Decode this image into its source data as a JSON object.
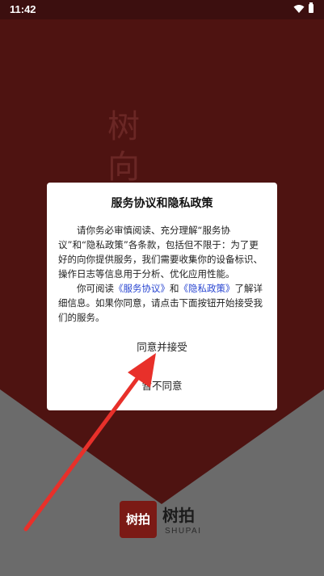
{
  "status_bar": {
    "time": "11:42",
    "icons": [
      "wifi-icon",
      "battery-icon"
    ]
  },
  "splash": {
    "slogan_vertical": "树向着",
    "brand_logo_text": "树拍",
    "brand_name": "树拍",
    "brand_subtitle": "SHUPAI",
    "colors": {
      "background_red": "#4e1311",
      "envelope_gray": "#6b6b6b",
      "logo_red": "#7b1a15"
    }
  },
  "dialog": {
    "title": "服务协议和隐私政策",
    "paragraph1": "请你务必审慎阅读、充分理解“服务协议”和“隐私政策”各条款，包括但不限于：为了更好的向你提供服务，我们需要收集你的设备标识、操作日志等信息用于分析、优化应用性能。",
    "paragraph2_prefix": "你可阅读",
    "terms_link": "《服务协议》",
    "paragraph2_and": "和",
    "privacy_link": "《隐私政策》",
    "paragraph2_suffix": "了解详细信息。如果你同意，请点击下面按钮开始接受我们的服务。",
    "agree_label": "同意并接受",
    "disagree_label": "暂不同意",
    "link_color": "#2946d1"
  },
  "annotation": {
    "arrow_color": "#e8302a"
  }
}
